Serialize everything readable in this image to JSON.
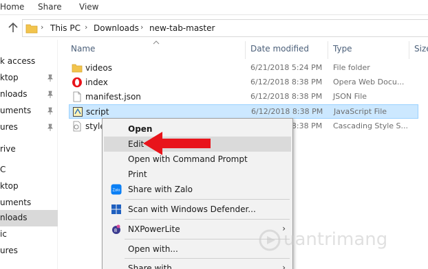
{
  "ribbon": {
    "tabs": [
      "Home",
      "Share",
      "View"
    ]
  },
  "address": {
    "crumbs": [
      "This PC",
      "Downloads",
      "new-tab-master"
    ]
  },
  "navpane": {
    "items": [
      {
        "label": "k access",
        "pinned": false
      },
      {
        "label": "ktop",
        "pinned": true
      },
      {
        "label": "nloads",
        "pinned": true
      },
      {
        "label": "uments",
        "pinned": true
      },
      {
        "label": "ures",
        "pinned": true
      },
      {
        "label": "rive",
        "pinned": false
      },
      {
        "label": "C",
        "pinned": false
      },
      {
        "label": "ktop",
        "pinned": false
      },
      {
        "label": "uments",
        "pinned": false
      },
      {
        "label": "nloads",
        "pinned": false
      },
      {
        "label": "ic",
        "pinned": false
      },
      {
        "label": "ures",
        "pinned": false
      }
    ],
    "selected_index": 9
  },
  "filelist": {
    "columns": {
      "name": "Name",
      "date": "Date modified",
      "type": "Type",
      "size": "Size"
    },
    "rows": [
      {
        "name": "videos",
        "date": "6/21/2018 5:24 PM",
        "type": "File folder",
        "icon": "folder-icon"
      },
      {
        "name": "index",
        "date": "6/12/2018 8:38 PM",
        "type": "Opera Web Docu...",
        "icon": "opera-icon"
      },
      {
        "name": "manifest.json",
        "date": "6/12/2018 8:38 PM",
        "type": "JSON File",
        "icon": "file-icon"
      },
      {
        "name": "script",
        "date": "6/12/2018 8:38 PM",
        "type": "JavaScript File",
        "icon": "script-icon",
        "selected": true
      },
      {
        "name": "style",
        "date": "6/12/2018 8:38 PM",
        "type": "Cascading Style S...",
        "icon": "css-file-icon"
      }
    ]
  },
  "context_menu": {
    "items": [
      {
        "label": "Open",
        "bold": true
      },
      {
        "label": "Edit",
        "highlight": true
      },
      {
        "label": "Open with Command Prompt"
      },
      {
        "label": "Print"
      },
      {
        "label": "Share with Zalo",
        "icon": "zalo-icon"
      },
      {
        "label": "Scan with Windows Defender...",
        "icon": "defender-icon"
      },
      {
        "label": "NXPowerLite",
        "icon": "nxpowerlite-icon",
        "submenu": true
      },
      {
        "label": "Open with..."
      },
      {
        "label": "Share with",
        "submenu": true
      }
    ]
  },
  "watermark": {
    "text": "uantrimang"
  },
  "colors": {
    "selection_bg": "#cce8ff",
    "selection_border": "#99d1ff",
    "arrow_red": "#e8141b",
    "header_text": "#4c607a"
  }
}
